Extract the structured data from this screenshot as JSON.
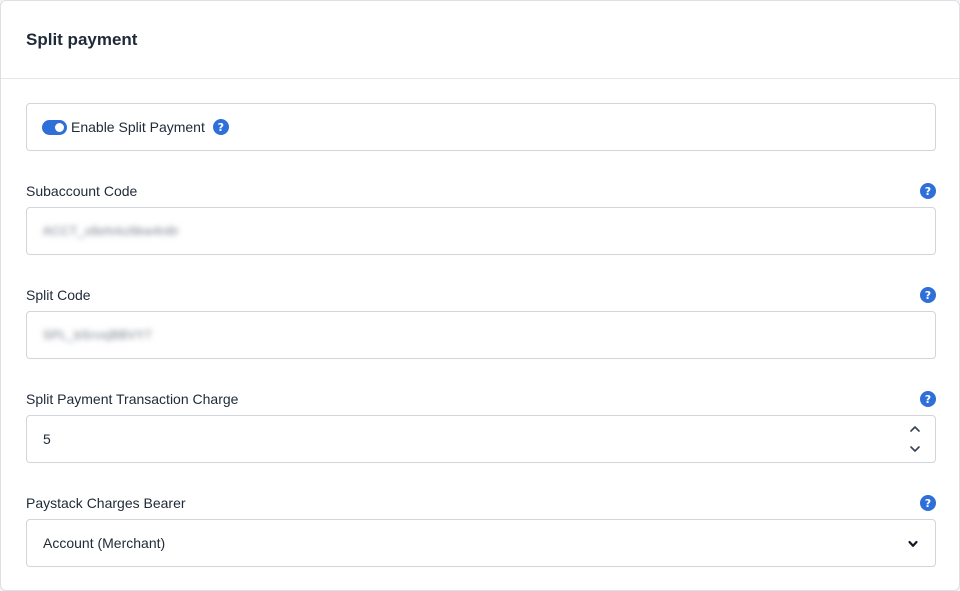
{
  "card": {
    "title": "Split payment"
  },
  "toggle": {
    "label": "Enable Split Payment",
    "enabled": true
  },
  "fields": {
    "subaccount": {
      "label": "Subaccount Code",
      "value": "ACCT_x8ehrkz6kw4n8r"
    },
    "split_code": {
      "label": "Split Code",
      "value": "SPL_bSrvxjBBVY7"
    },
    "charge": {
      "label": "Split Payment Transaction Charge",
      "value": "5"
    },
    "bearer": {
      "label": "Paystack Charges Bearer",
      "value": "Account (Merchant)"
    }
  },
  "help_glyph": "?",
  "colors": {
    "accent": "#2e6fd9",
    "border": "#d1d5db",
    "text": "#1f2937"
  },
  "icons": [
    "help-icon",
    "chevron-up-icon",
    "chevron-down-icon",
    "dropdown-arrow-icon"
  ]
}
